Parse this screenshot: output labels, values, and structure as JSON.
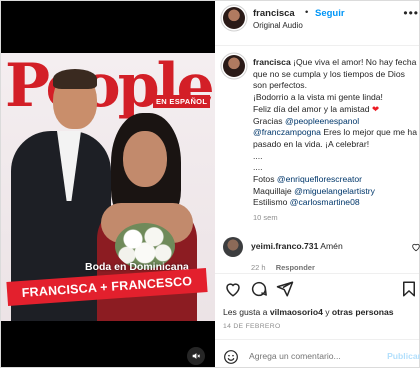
{
  "post": {
    "username": "francisca",
    "separator": "•",
    "follow_label": "Seguir",
    "audio_label": "Original Audio",
    "more_label": "•••",
    "cover": {
      "logo_text": "People",
      "badge_text": "EN ESPAÑOL",
      "subtitle": "Boda en Dominicana",
      "headline": "FRANCISCA + FRANCESCO"
    },
    "caption": {
      "username": "francisca",
      "line1": "¡Que viva el amor! No hay fecha que no se cumpla y los tiempos de Dios son perfectos.",
      "line2": "¡Bodorrio a la vista mi gente linda!",
      "line3": "Feliz día del amor y la amistad",
      "heart": "❤",
      "line4": "Gracias",
      "mention1": "@peopleenespanol",
      "mention2": "@franczampogna",
      "line5": "Eres lo mejor que me ha pasado en la vida. ¡A celebrar!",
      "dots1": "....",
      "dots2": "....",
      "fotos_label": "Fotos",
      "mention3": "@enriqueflorescreator",
      "maquillaje_label": "Maquillaje",
      "mention4": "@miguelangelartistry",
      "estilismo_label": "Estilismo",
      "mention5": "@carlosmartine08",
      "time": "10 sem"
    },
    "comment": {
      "username": "yeimi.franco.731",
      "text": "Amén",
      "time": "22 h",
      "reply_label": "Responder"
    },
    "likes": {
      "prefix": "Les gusta a",
      "user": "vilmaosorio4",
      "middle": "y",
      "others": "otras personas"
    },
    "date": "14 DE FEBRERO",
    "add_comment": {
      "placeholder": "Agrega un comentario...",
      "post_label": "Publicar"
    }
  },
  "icons": {
    "more": "more-icon",
    "mute": "mute-icon",
    "heart": "heart-icon",
    "comment": "comment-icon",
    "share": "share-icon",
    "save": "bookmark-icon",
    "emoji": "emoji-icon"
  },
  "colors": {
    "accent": "#0095f6",
    "people_red": "#d31f27",
    "headline_red": "#e3202d",
    "post_disabled": "#b2dffc"
  }
}
